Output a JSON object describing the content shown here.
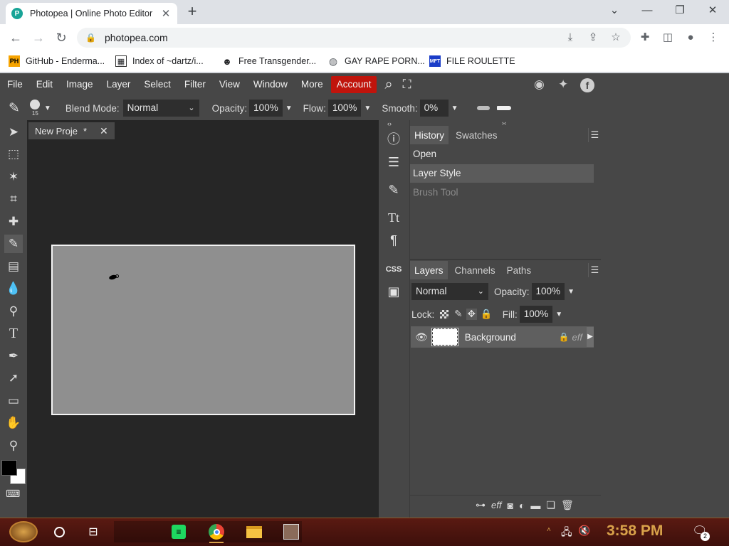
{
  "browser": {
    "tab_title": "Photopea | Online Photo Editor",
    "tab_favicon": "P",
    "url": "photopea.com",
    "bookmarks": [
      {
        "label": "GitHub - Enderma...",
        "icon": "PH"
      },
      {
        "label": "Index of ~dartz/i...",
        "icon": "grid-icon"
      },
      {
        "label": "Free Transgender...",
        "icon": "mask-icon"
      },
      {
        "label": "GAY RAPE PORN...",
        "icon": "globe-icon"
      },
      {
        "label": "FILE ROULETTE",
        "icon": "MFT"
      }
    ]
  },
  "menubar": {
    "items": [
      "File",
      "Edit",
      "Image",
      "Layer",
      "Select",
      "Filter",
      "View",
      "Window",
      "More"
    ],
    "account": "Account"
  },
  "options": {
    "brush_size": "15",
    "blend_label": "Blend Mode:",
    "blend_value": "Normal",
    "opacity_label": "Opacity:",
    "opacity_value": "100%",
    "flow_label": "Flow:",
    "flow_value": "100%",
    "smooth_label": "Smooth:",
    "smooth_value": "0%"
  },
  "document": {
    "tab_title": "New Proje",
    "modified_mark": "*"
  },
  "history_panel": {
    "tabs": [
      "History",
      "Swatches"
    ],
    "steps": [
      "Open",
      "Layer Style",
      "Brush Tool"
    ]
  },
  "layers_panel": {
    "tabs": [
      "Layers",
      "Channels",
      "Paths"
    ],
    "blend_value": "Normal",
    "opacity_label": "Opacity:",
    "opacity_value": "100%",
    "lock_label": "Lock:",
    "fill_label": "Fill:",
    "fill_value": "100%",
    "layer_name": "Background",
    "fx_label": "eff",
    "footer_fx": "eff"
  },
  "taskbar": {
    "time": "3:58 PM",
    "notif_count": "2"
  },
  "colors": {
    "accent": "#c0140c",
    "panel": "#474747",
    "workspace": "#262626",
    "canvas": "#8f8f8f"
  }
}
